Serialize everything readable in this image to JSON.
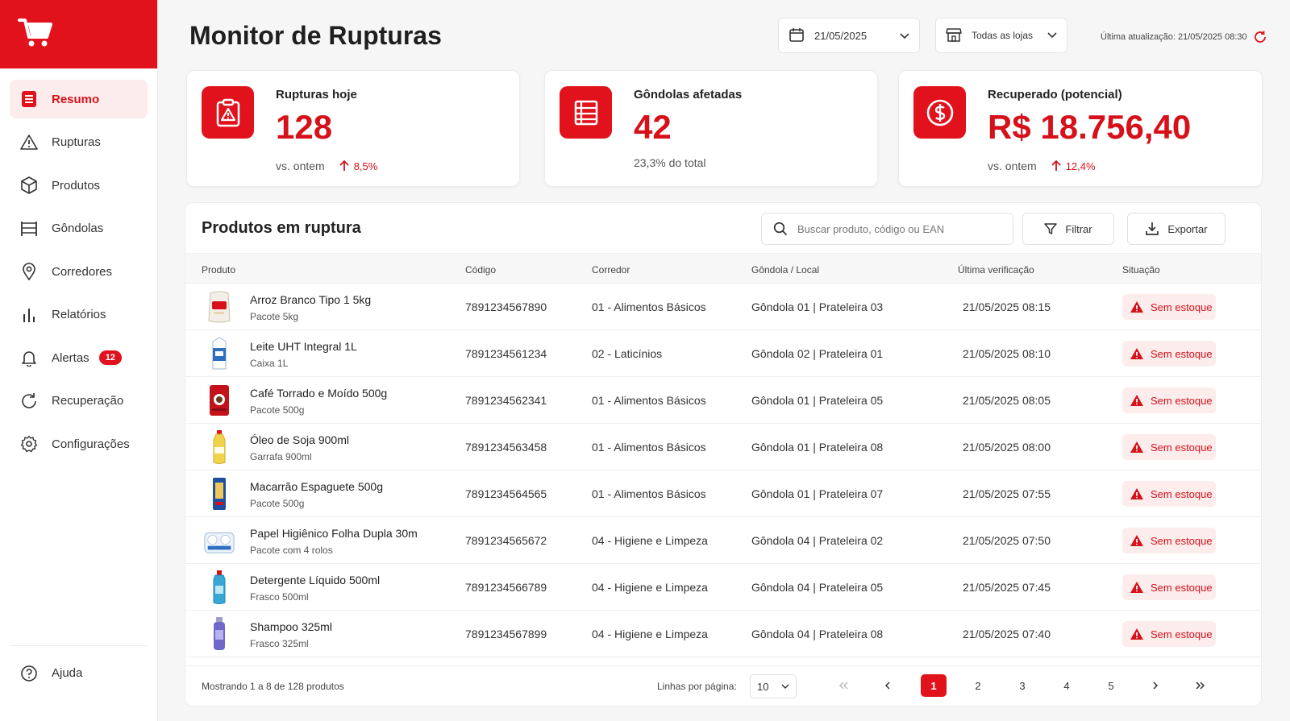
{
  "app": {
    "title": "Monitor de Rupturas"
  },
  "sidebar": {
    "items": [
      {
        "label": "Resumo",
        "icon": "list-icon",
        "active": true
      },
      {
        "label": "Rupturas",
        "icon": "warning-icon"
      },
      {
        "label": "Produtos",
        "icon": "box-icon"
      },
      {
        "label": "Gôndolas",
        "icon": "shelf-icon"
      },
      {
        "label": "Corredores",
        "icon": "location-pin-icon"
      },
      {
        "label": "Relatórios",
        "icon": "bar-chart-icon"
      },
      {
        "label": "Alertas",
        "icon": "bell-icon",
        "badge": "12"
      },
      {
        "label": "Recuperação",
        "icon": "refresh-icon"
      },
      {
        "label": "Configurações",
        "icon": "gear-icon"
      }
    ],
    "help": {
      "label": "Ajuda",
      "icon": "help-icon"
    }
  },
  "header": {
    "date": "21/05/2025",
    "store": "Todas as lojas",
    "updated": "Última atualização: 21/05/2025 08:30"
  },
  "kpis": [
    {
      "label": "Rupturas hoje",
      "value": "128",
      "sub": "vs. ontem",
      "delta": "8,5%",
      "icon": "clipboard-alert-icon"
    },
    {
      "label": "Gôndolas afetadas",
      "value": "42",
      "sub": "23,3% do total",
      "icon": "shelf-list-icon"
    },
    {
      "label": "Recuperado (potencial)",
      "value": "R$ 18.756,40",
      "sub": "vs. ontem",
      "delta": "12,4%",
      "icon": "dollar-circle-icon"
    }
  ],
  "table": {
    "title": "Produtos em ruptura",
    "search_placeholder": "Buscar produto, código ou EAN",
    "filter_label": "Filtrar",
    "export_label": "Exportar",
    "columns": [
      "Produto",
      "Código",
      "Corredor",
      "Gôndola / Local",
      "Última verificação",
      "Situação"
    ],
    "rows": [
      {
        "name": "Arroz Branco Tipo 1 5kg",
        "sub": "Pacote 5kg",
        "code": "7891234567890",
        "aisle": "01 - Alimentos Básicos",
        "location": "Gôndola 01 | Prateleira 03",
        "checked": "21/05/2025 08:15",
        "status": "Sem estoque",
        "thumb": "rice-bag"
      },
      {
        "name": "Leite UHT Integral 1L",
        "sub": "Caixa 1L",
        "code": "7891234561234",
        "aisle": "02 - Laticínios",
        "location": "Gôndola 02 | Prateleira 01",
        "checked": "21/05/2025 08:10",
        "status": "Sem estoque",
        "thumb": "milk-carton"
      },
      {
        "name": "Café Torrado e Moído 500g",
        "sub": "Pacote 500g",
        "code": "7891234562341",
        "aisle": "01 - Alimentos Básicos",
        "location": "Gôndola 01 | Prateleira 05",
        "checked": "21/05/2025 08:05",
        "status": "Sem estoque",
        "thumb": "coffee-pack"
      },
      {
        "name": "Óleo de Soja 900ml",
        "sub": "Garrafa 900ml",
        "code": "7891234563458",
        "aisle": "01 - Alimentos Básicos",
        "location": "Gôndola 01 | Prateleira 08",
        "checked": "21/05/2025 08:00",
        "status": "Sem estoque",
        "thumb": "oil-bottle"
      },
      {
        "name": "Macarrão Espaguete 500g",
        "sub": "Pacote 500g",
        "code": "7891234564565",
        "aisle": "01 - Alimentos Básicos",
        "location": "Gôndola 01 | Prateleira 07",
        "checked": "21/05/2025 07:55",
        "status": "Sem estoque",
        "thumb": "pasta-pack"
      },
      {
        "name": "Papel Higiênico Folha Dupla 30m",
        "sub": "Pacote com 4 rolos",
        "code": "7891234565672",
        "aisle": "04 - Higiene e Limpeza",
        "location": "Gôndola 04 | Prateleira 02",
        "checked": "21/05/2025 07:50",
        "status": "Sem estoque",
        "thumb": "toilet-paper"
      },
      {
        "name": "Detergente Líquido 500ml",
        "sub": "Frasco 500ml",
        "code": "7891234566789",
        "aisle": "04 - Higiene e Limpeza",
        "location": "Gôndola 04 | Prateleira 05",
        "checked": "21/05/2025 07:45",
        "status": "Sem estoque",
        "thumb": "detergent-bottle"
      },
      {
        "name": "Shampoo 325ml",
        "sub": "Frasco 325ml",
        "code": "7891234567899",
        "aisle": "04 - Higiene e Limpeza",
        "location": "Gôndola 04 | Prateleira 08",
        "checked": "21/05/2025 07:40",
        "status": "Sem estoque",
        "thumb": "shampoo-bottle"
      }
    ],
    "footer": {
      "showing": "Mostrando 1 a 8 de 128 produtos",
      "rows_per_page_label": "Linhas por página:",
      "rows_per_page": "10",
      "pages": [
        "1",
        "2",
        "3",
        "4",
        "5"
      ],
      "current_page": "1"
    }
  },
  "colors": {
    "brand": "#e1121b",
    "brand_light": "#fdecec"
  }
}
